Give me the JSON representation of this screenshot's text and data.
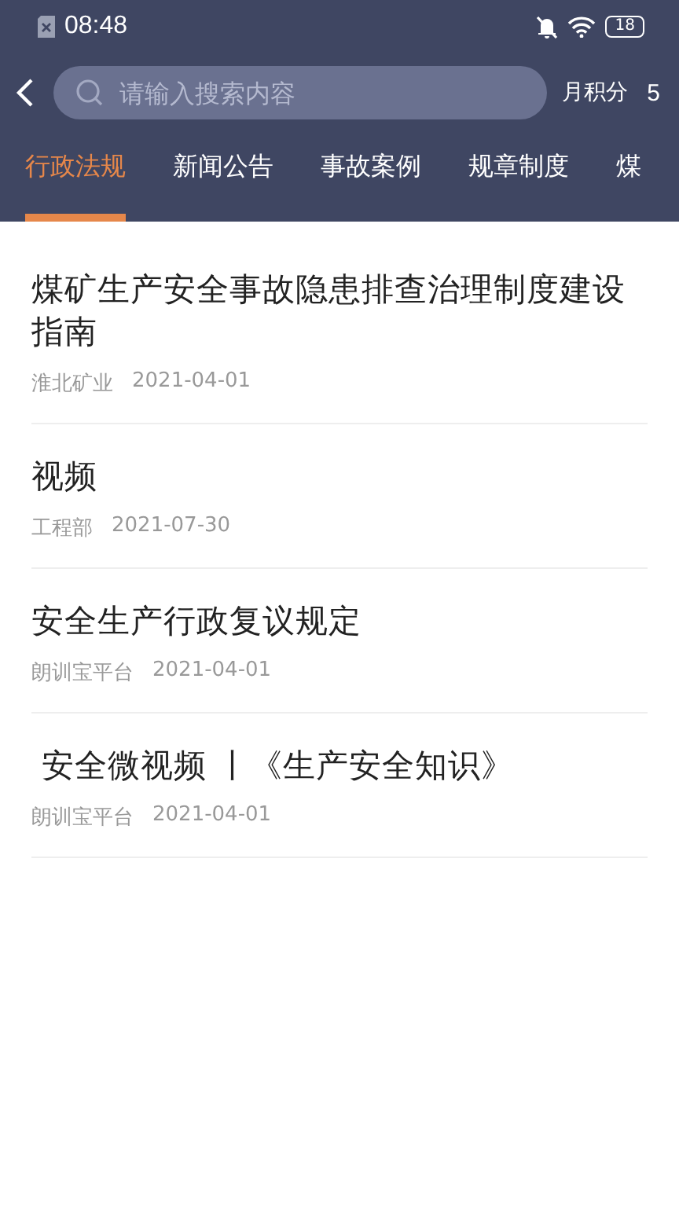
{
  "status_bar": {
    "time": "08:48",
    "battery": "18"
  },
  "header": {
    "search": {
      "placeholder": "请输入搜索内容"
    },
    "points_label": "月积分",
    "points_value": "5"
  },
  "tabs": [
    {
      "label": "行政法规",
      "selected": true
    },
    {
      "label": "新闻公告",
      "selected": false
    },
    {
      "label": "事故案例",
      "selected": false
    },
    {
      "label": "规章制度",
      "selected": false
    },
    {
      "label": "煤",
      "selected": false
    }
  ],
  "articles": [
    {
      "title": "煤矿生产安全事故隐患排查治理制度建设指南",
      "source": "淮北矿业",
      "date": "2021-04-01"
    },
    {
      "title": "视频",
      "source": "工程部",
      "date": "2021-07-30"
    },
    {
      "title": "安全生产行政复议规定",
      "source": "朗训宝平台",
      "date": "2021-04-01"
    },
    {
      "title": " 安全微视频 丨《生产安全知识》",
      "source": "朗训宝平台",
      "date": "2021-04-01"
    }
  ]
}
